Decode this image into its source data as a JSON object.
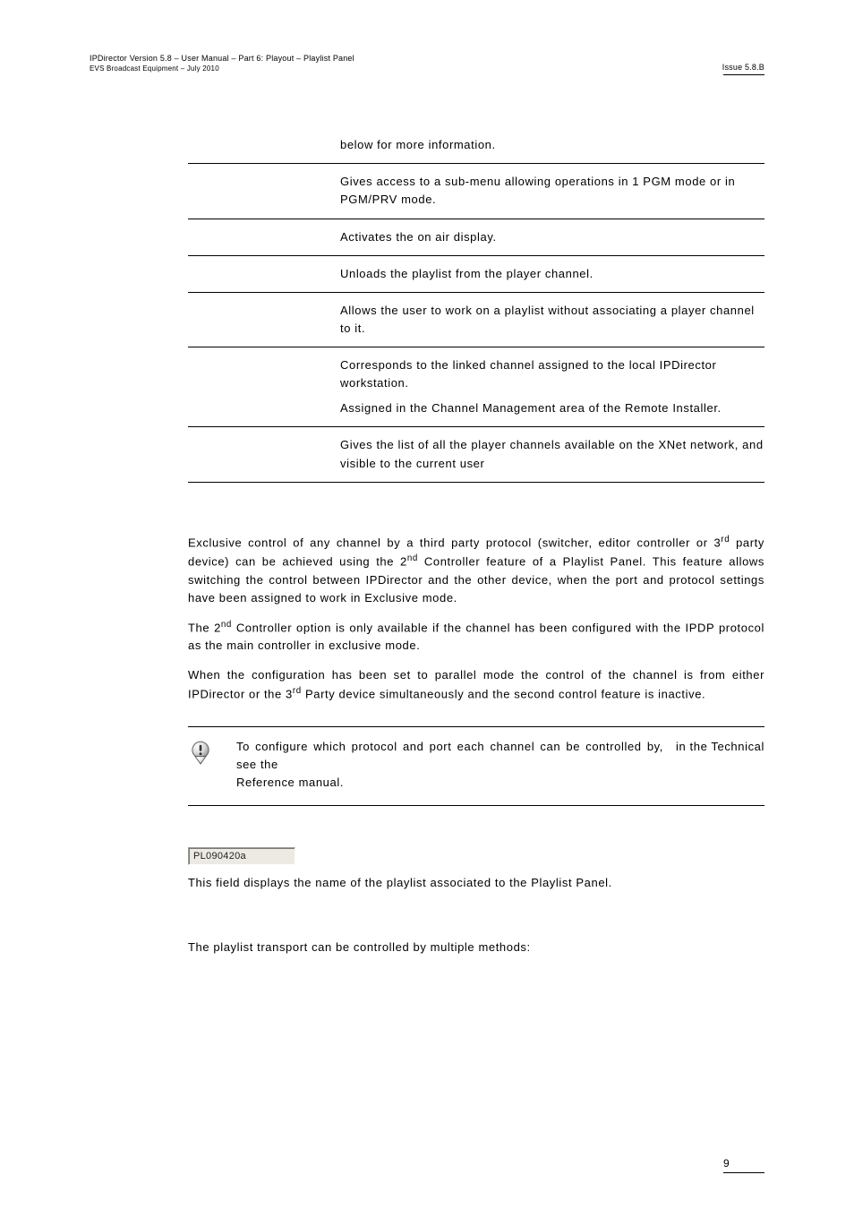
{
  "header": {
    "left_line1": "IPDirector Version 5.8 – User Manual – Part 6: Playout – Playlist Panel",
    "left_line2": "EVS Broadcast Equipment – July 2010",
    "right": "Issue 5.8.B"
  },
  "table_rows": [
    {
      "col1": "",
      "col2": "below for more information."
    },
    {
      "col1": "",
      "col2": "Gives access to a sub-menu allowing operations in 1 PGM mode or in PGM/PRV mode."
    },
    {
      "col1": "",
      "col2": "Activates the on air display."
    },
    {
      "col1": "",
      "col2": "Unloads the playlist from the player channel."
    },
    {
      "col1": "",
      "col2": "Allows the user to work on a playlist without associating a player channel to it."
    },
    {
      "col1": "",
      "col2_a": "Corresponds to the linked channel assigned to the local IPDirector workstation.",
      "col2_b": "Assigned in the Channel Management area of the Remote Installer."
    },
    {
      "col1": "",
      "col2": "Gives the list of all the player channels available on the XNet network, and visible to the current user"
    }
  ],
  "paragraphs": {
    "p1_pre": "Exclusive control of any channel by a third party protocol (switcher, editor controller or 3",
    "p1_sup1": "rd",
    "p1_mid1": " party device) can be achieved using the 2",
    "p1_sup2": "nd",
    "p1_post": " Controller feature of a Playlist Panel. This feature allows switching the control between IPDirector and the other device, when the port and protocol settings have been assigned to work in Exclusive mode.",
    "p2_pre": "The 2",
    "p2_sup": "nd",
    "p2_post": " Controller option is only available if the channel has been configured with the IPDP protocol as the main controller in exclusive mode.",
    "p3_pre": "When the configuration has been set to parallel mode the control of the channel is from either IPDirector or the 3",
    "p3_sup": "rd",
    "p3_post": " Party device simultaneously and the second control feature is inactive."
  },
  "note": {
    "line1": "To configure which protocol and port each channel can be controlled by, see the",
    "line1_right": "in the Technical",
    "line2": "Reference manual."
  },
  "inset_label": "PL090420a",
  "after_inset": "This field displays the name of the playlist associated to the Playlist Panel.",
  "last_para": "The playlist transport can be controlled by multiple methods:",
  "page_number": "9"
}
